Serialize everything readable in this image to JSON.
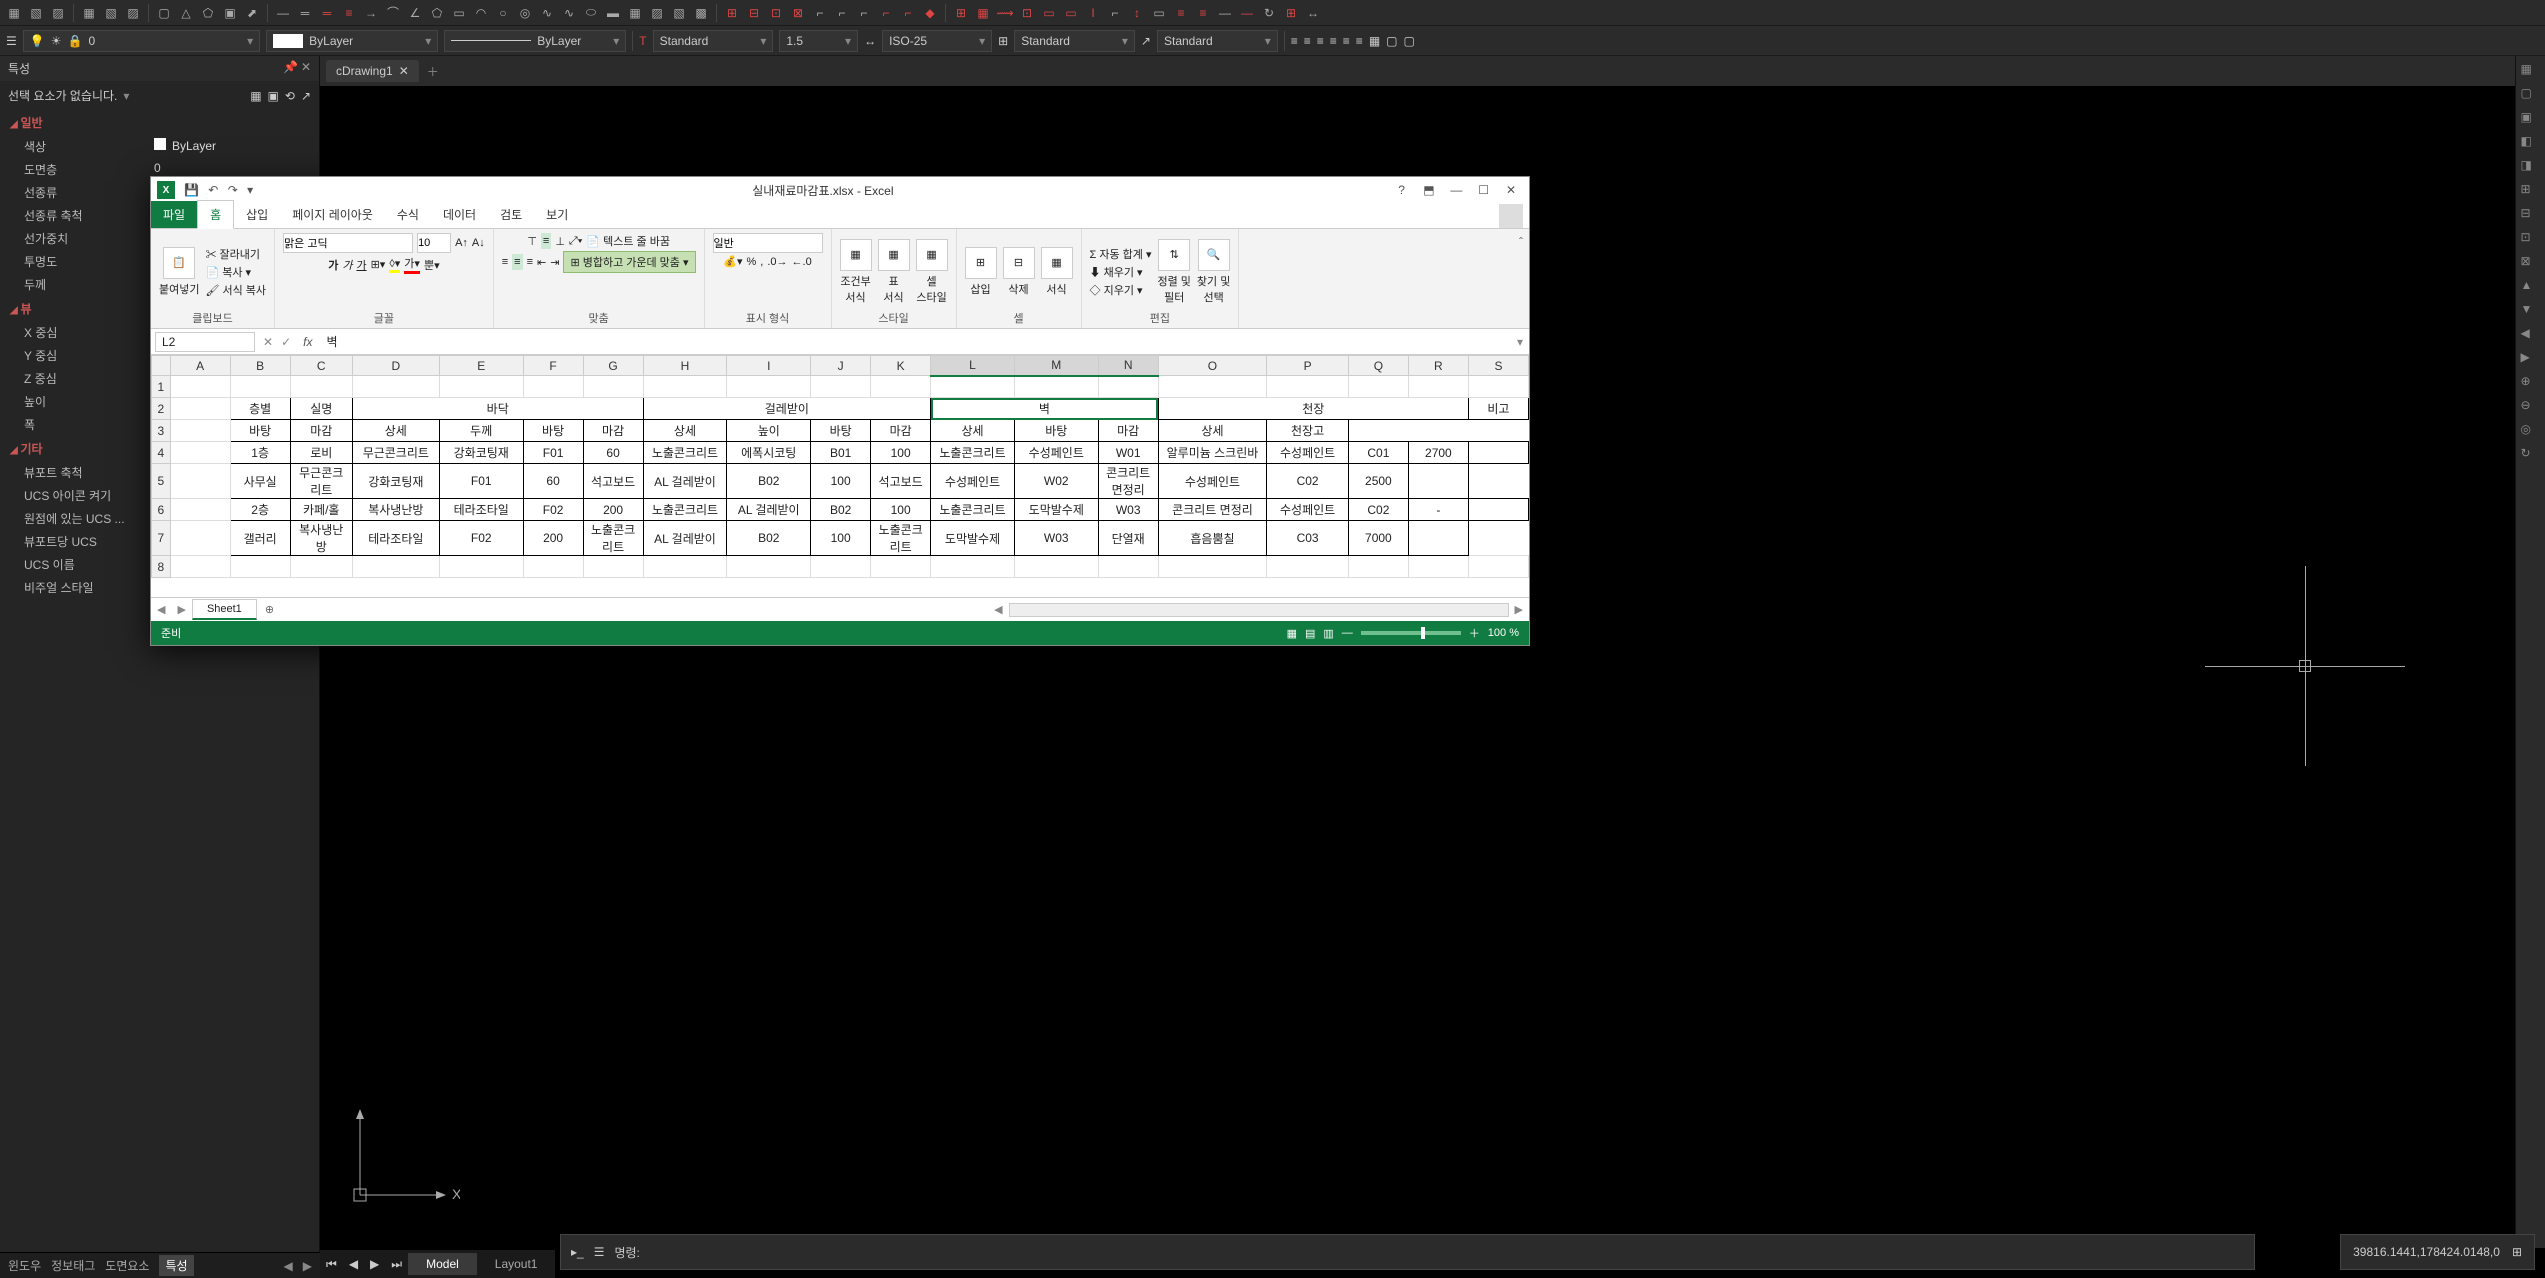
{
  "cad": {
    "props_title": "특성",
    "no_selection": "선택 요소가 없습니다.",
    "sections": {
      "general": "일반",
      "view": "뷰",
      "misc": "기타"
    },
    "general_rows": [
      {
        "k": "색상",
        "v": "ByLayer",
        "swatch": true
      },
      {
        "k": "도면층",
        "v": "0"
      },
      {
        "k": "선종류",
        "v": ""
      },
      {
        "k": "선종류 축척",
        "v": ""
      },
      {
        "k": "선가중치",
        "v": ""
      },
      {
        "k": "투명도",
        "v": ""
      },
      {
        "k": "두께",
        "v": ""
      }
    ],
    "view_rows": [
      {
        "k": "X 중심",
        "v": ""
      },
      {
        "k": "Y 중심",
        "v": ""
      },
      {
        "k": "Z 중심",
        "v": ""
      },
      {
        "k": "높이",
        "v": ""
      },
      {
        "k": "폭",
        "v": ""
      }
    ],
    "misc_rows": [
      {
        "k": "뷰포트 축척",
        "v": ""
      },
      {
        "k": "UCS 아이콘 켜기",
        "v": ""
      },
      {
        "k": "원점에 있는 UCS ...",
        "v": ""
      },
      {
        "k": "뷰포트당 UCS",
        "v": ""
      },
      {
        "k": "UCS 이름",
        "v": ""
      },
      {
        "k": "비주얼 스타일",
        "v": ""
      }
    ],
    "row2": {
      "layer": "0",
      "bylayer": "ByLayer",
      "bylayer2": "ByLayer",
      "textstyle": "Standard",
      "dim": "1.5",
      "iso": "ISO-25",
      "tbl": "Standard",
      "mls": "Standard"
    },
    "drawing_tab": "cDrawing1",
    "cmd_label": "명령:",
    "coords": "39816.1441,178424.0148,0",
    "model": "Model",
    "layout": "Layout1",
    "status_tabs": [
      "윈도우",
      "정보태그",
      "도면요소",
      "특성"
    ]
  },
  "excel": {
    "title": "실내재료마감표.xlsx - Excel",
    "tabs": {
      "file": "파일",
      "home": "홈",
      "insert": "삽입",
      "pageLayout": "페이지 레이아웃",
      "formulas": "수식",
      "data": "데이터",
      "review": "검토",
      "view": "보기"
    },
    "ribbon": {
      "clipboard": {
        "label": "클립보드",
        "paste": "붙여넣기",
        "cut": "잘라내기",
        "copy": "복사",
        "format": "서식 복사"
      },
      "font": {
        "label": "글꼴",
        "name": "맑은 고딕",
        "size": "10"
      },
      "align": {
        "label": "맞춤",
        "wrap": "텍스트 줄 바꿈",
        "merge": "병합하고 가운데 맞춤"
      },
      "number": {
        "label": "표시 형식",
        "general": "일반"
      },
      "styles": {
        "label": "스타일",
        "cond": "조건부\n서식",
        "table": "표\n서식",
        "cell": "셀\n스타일"
      },
      "cells": {
        "label": "셀",
        "insert": "삽입",
        "delete": "삭제",
        "format": "서식"
      },
      "editing": {
        "label": "편집",
        "sum": "자동 합계",
        "fill": "채우기",
        "clear": "지우기",
        "sort": "정렬 및\n필터",
        "find": "찾기 및\n선택"
      }
    },
    "namebox": "L2",
    "formula_value": "벽",
    "columns": [
      "A",
      "B",
      "C",
      "D",
      "E",
      "F",
      "G",
      "H",
      "I",
      "J",
      "K",
      "L",
      "M",
      "N",
      "O",
      "P",
      "Q",
      "R",
      "S"
    ],
    "sel_cols": [
      "L",
      "M",
      "N"
    ],
    "header1": {
      "B": "층별",
      "C": "실명",
      "D": "바닥",
      "H": "걸레받이",
      "L": "벽",
      "O": "천장",
      "S": "비고"
    },
    "header2": {
      "D": "바탕",
      "E": "마감",
      "F": "상세",
      "G": "두께",
      "H": "바탕",
      "I": "마감",
      "J": "상세",
      "K": "높이",
      "L": "바탕",
      "M": "마감",
      "N": "상세",
      "O": "바탕",
      "P": "마감",
      "Q": "상세",
      "R": "천장고"
    },
    "rows": [
      {
        "B": "1층",
        "C": "로비",
        "D": "무근콘크리트",
        "E": "강화코팅재",
        "F": "F01",
        "G": "60",
        "H": "노출콘크리트",
        "I": "에폭시코팅",
        "J": "B01",
        "K": "100",
        "L": "노출콘크리트",
        "M": "수성페인트",
        "N": "W01",
        "O": "알루미늄 스크린바",
        "P": "수성페인트",
        "Q": "C01",
        "R": "2700",
        "S": ""
      },
      {
        "B": "",
        "C": "사무실",
        "D": "무근콘크리트",
        "E": "강화코팅재",
        "F": "F01",
        "G": "60",
        "H": "석고보드",
        "I": "AL 걸레받이",
        "J": "B02",
        "K": "100",
        "L": "석고보드",
        "M": "수성페인트",
        "N": "W02",
        "O": "콘크리트 면정리",
        "P": "수성페인트",
        "Q": "C02",
        "R": "2500",
        "S": ""
      },
      {
        "B": "2층",
        "C": "카페/홀",
        "D": "복사냉난방",
        "E": "테라조타일",
        "F": "F02",
        "G": "200",
        "H": "노출콘크리트",
        "I": "AL 걸레받이",
        "J": "B02",
        "K": "100",
        "L": "노출콘크리트",
        "M": "도막발수제",
        "N": "W03",
        "O": "콘크리트 면정리",
        "P": "수성페인트",
        "Q": "C02",
        "R": "-",
        "S": ""
      },
      {
        "B": "",
        "C": "갤러리",
        "D": "복사냉난방",
        "E": "테라조타일",
        "F": "F02",
        "G": "200",
        "H": "노출콘크리트",
        "I": "AL 걸레받이",
        "J": "B02",
        "K": "100",
        "L": "노출콘크리트",
        "M": "도막발수제",
        "N": "W03",
        "O": "단열재",
        "P": "흡음뿜칠",
        "Q": "C03",
        "R": "7000",
        "S": ""
      }
    ],
    "sheet_name": "Sheet1",
    "status": "준비",
    "zoom": "100 %"
  }
}
